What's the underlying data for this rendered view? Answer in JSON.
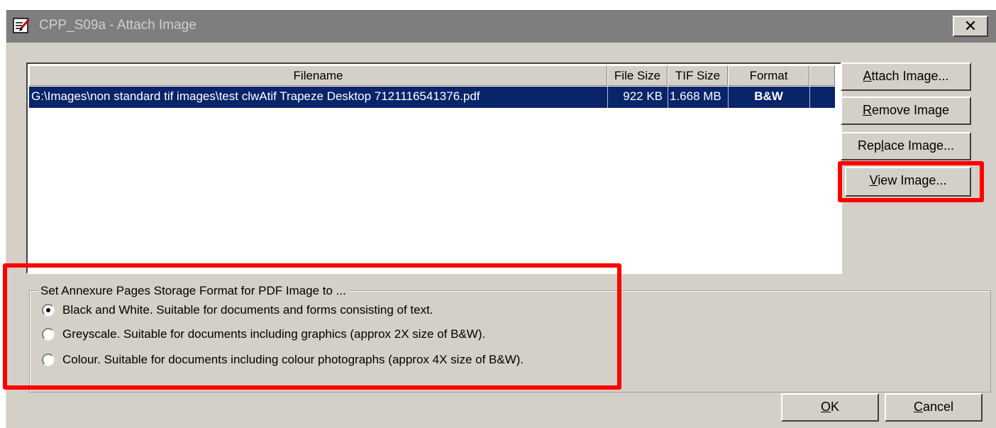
{
  "window": {
    "title": "CPP_S09a - Attach Image",
    "close_label": "✕"
  },
  "table": {
    "columns": [
      "Filename",
      "File Size",
      "TIF Size",
      "Format"
    ],
    "rows": [
      {
        "filename": "G:\\Images\\non standard tif images\\test clwAtif  Trapeze Desktop 7121116541376.pdf",
        "file_size": "922 KB",
        "tif_size": "1.668 MB",
        "format": "B&W"
      }
    ]
  },
  "buttons": {
    "attach": {
      "mnemonic": "A",
      "rest": "ttach Image..."
    },
    "remove": {
      "mnemonic": "R",
      "rest": "emove Image"
    },
    "replace": {
      "pre": "Rep",
      "mnemonic": "l",
      "rest": "ace Image..."
    },
    "view": {
      "mnemonic": "V",
      "rest": "iew Image..."
    },
    "ok": {
      "mnemonic": "O",
      "rest": "K"
    },
    "cancel": {
      "mnemonic": "C",
      "rest": "ancel"
    }
  },
  "storage_group": {
    "legend": "Set Annexure Pages Storage Format for PDF Image to ...",
    "options": [
      {
        "label": "Black and White. Suitable for documents and forms consisting of text.",
        "selected": true
      },
      {
        "label": "Greyscale. Suitable for documents including graphics (approx 2X size of B&W).",
        "selected": false
      },
      {
        "label": "Colour. Suitable for documents including colour photographs (approx 4X size of B&W).",
        "selected": false
      }
    ]
  },
  "colors": {
    "selection": "#0a246a",
    "highlight": "#ff0000",
    "face": "#d4d0c8"
  }
}
